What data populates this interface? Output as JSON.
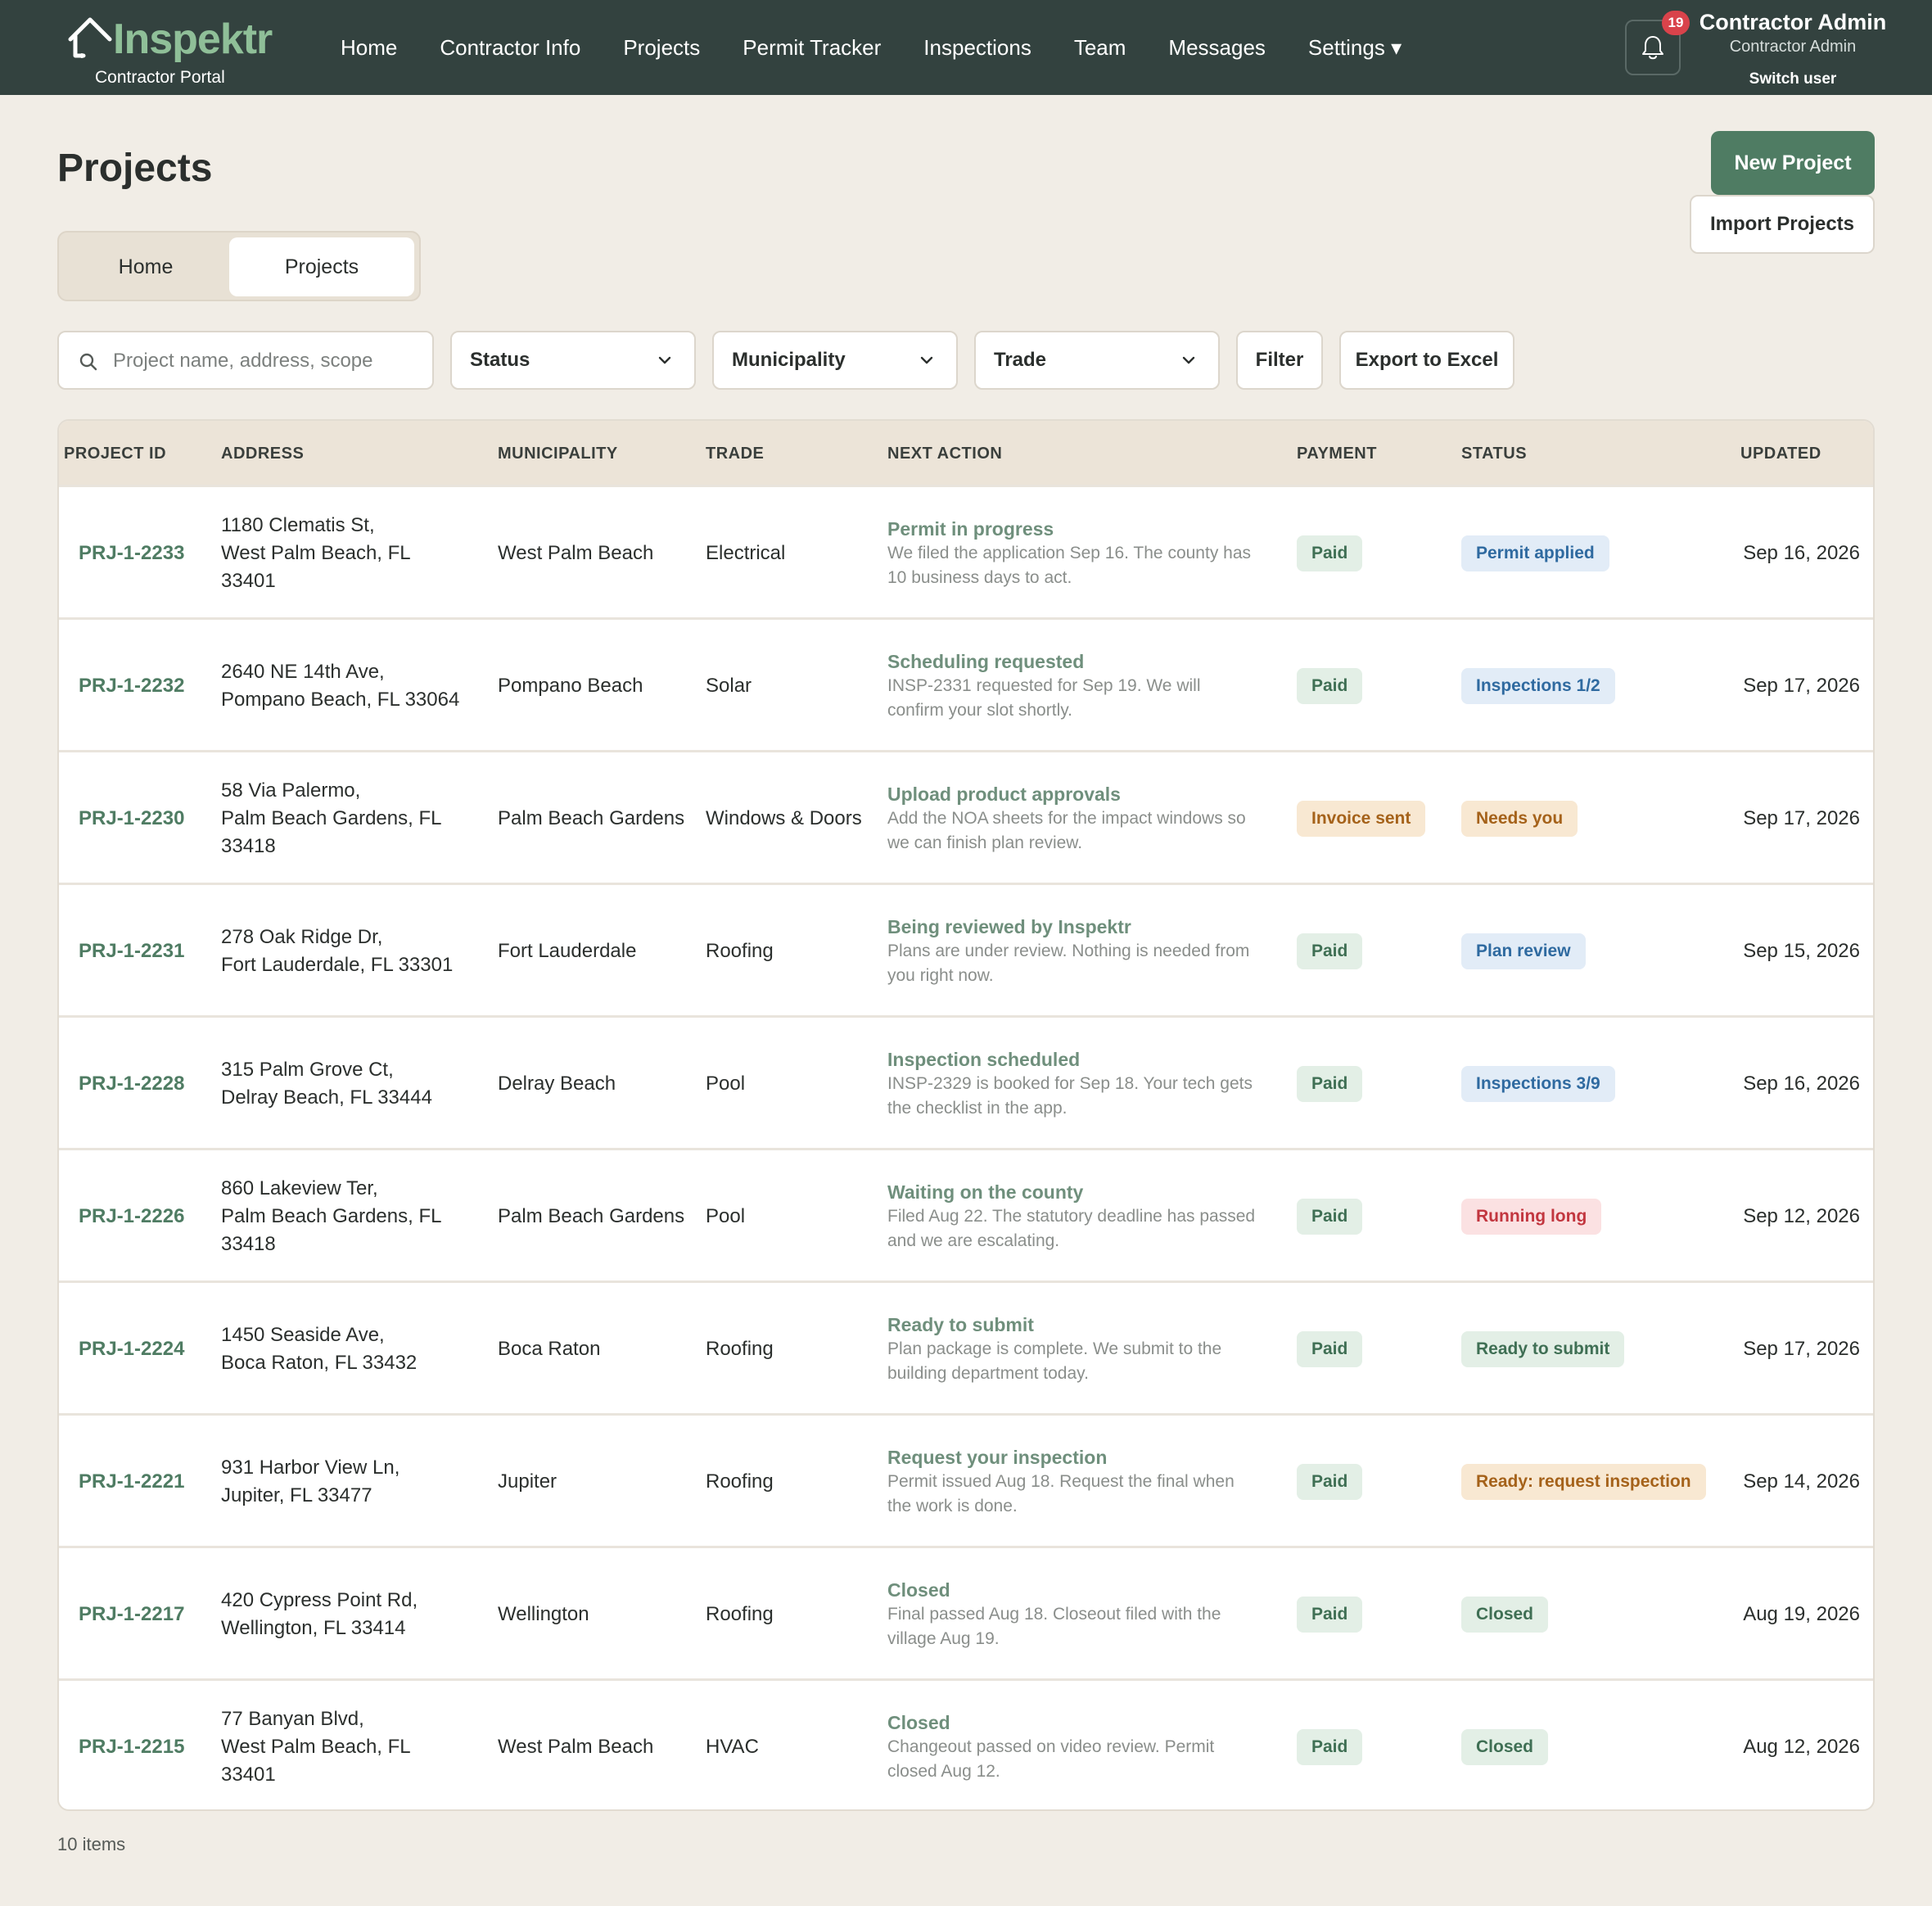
{
  "brand": {
    "name": "Inspektr",
    "subtitle": "Contractor Portal"
  },
  "nav": [
    "Home",
    "Contractor Info",
    "Projects",
    "Permit Tracker",
    "Inspections",
    "Team",
    "Messages",
    "Settings ▾"
  ],
  "notifications": {
    "count": "19"
  },
  "user": {
    "name": "Contractor Admin",
    "role": "Contractor Admin",
    "switch_label": "Switch user"
  },
  "page": {
    "title": "Projects",
    "new_project_label": "New Project",
    "import_projects_label": "Import Projects"
  },
  "tabs": {
    "home": "Home",
    "projects": "Projects",
    "active": "Projects"
  },
  "filters": {
    "search_placeholder": "Project name, address, scope",
    "search_value": "",
    "status_label": "Status",
    "municipality_label": "Municipality",
    "trade_label": "Trade",
    "filter_label": "Filter",
    "export_label": "Export to Excel"
  },
  "table": {
    "headers": [
      "PROJECT ID",
      "ADDRESS",
      "MUNICIPALITY",
      "TRADE",
      "NEXT ACTION",
      "PAYMENT",
      "STATUS",
      "UPDATED"
    ],
    "rows": [
      {
        "id": "PRJ-1-2233",
        "address_line1": "1180 Clematis St,",
        "address_line2": "West Palm Beach, FL",
        "address_line3": "33401",
        "municipality": "West Palm Beach",
        "trade": "Electrical",
        "next_title": "Permit in progress",
        "next_desc": "We filed the application Sep 16. The county has 10 business days to act.",
        "payment": "Paid",
        "payment_tone": "green",
        "status": "Permit applied",
        "status_tone": "blue",
        "updated": "Sep 16, 2026"
      },
      {
        "id": "PRJ-1-2232",
        "address_line1": "2640 NE 14th Ave,",
        "address_line2": "Pompano Beach, FL 33064",
        "address_line3": "",
        "municipality": "Pompano Beach",
        "trade": "Solar",
        "next_title": "Scheduling requested",
        "next_desc": "INSP-2331 requested for Sep 19. We will confirm your slot shortly.",
        "payment": "Paid",
        "payment_tone": "green",
        "status": "Inspections 1/2",
        "status_tone": "blue",
        "updated": "Sep 17, 2026"
      },
      {
        "id": "PRJ-1-2230",
        "address_line1": "58 Via Palermo,",
        "address_line2": "Palm Beach Gardens, FL",
        "address_line3": "33418",
        "municipality": "Palm Beach Gardens",
        "trade": "Windows & Doors",
        "next_title": "Upload product approvals",
        "next_desc": "Add the NOA sheets for the impact windows so we can finish plan review.",
        "payment": "Invoice sent",
        "payment_tone": "amber",
        "status": "Needs you",
        "status_tone": "amber",
        "updated": "Sep 17, 2026"
      },
      {
        "id": "PRJ-1-2231",
        "address_line1": "278 Oak Ridge Dr,",
        "address_line2": "Fort Lauderdale, FL 33301",
        "address_line3": "",
        "municipality": "Fort Lauderdale",
        "trade": "Roofing",
        "next_title": "Being reviewed by Inspektr",
        "next_desc": "Plans are under review. Nothing is needed from you right now.",
        "payment": "Paid",
        "payment_tone": "green",
        "status": "Plan review",
        "status_tone": "blue",
        "updated": "Sep 15, 2026"
      },
      {
        "id": "PRJ-1-2228",
        "address_line1": "315 Palm Grove Ct,",
        "address_line2": "Delray Beach, FL 33444",
        "address_line3": "",
        "municipality": "Delray Beach",
        "trade": "Pool",
        "next_title": "Inspection scheduled",
        "next_desc": "INSP-2329 is booked for Sep 18. Your tech gets the checklist in the app.",
        "payment": "Paid",
        "payment_tone": "green",
        "status": "Inspections 3/9",
        "status_tone": "blue",
        "updated": "Sep 16, 2026"
      },
      {
        "id": "PRJ-1-2226",
        "address_line1": "860 Lakeview Ter,",
        "address_line2": "Palm Beach Gardens, FL",
        "address_line3": "33418",
        "municipality": "Palm Beach Gardens",
        "trade": "Pool",
        "next_title": "Waiting on the county",
        "next_desc": "Filed Aug 22. The statutory deadline has passed and we are escalating.",
        "payment": "Paid",
        "payment_tone": "green",
        "status": "Running long",
        "status_tone": "red",
        "updated": "Sep 12, 2026"
      },
      {
        "id": "PRJ-1-2224",
        "address_line1": "1450 Seaside Ave,",
        "address_line2": "Boca Raton, FL 33432",
        "address_line3": "",
        "municipality": "Boca Raton",
        "trade": "Roofing",
        "next_title": "Ready to submit",
        "next_desc": "Plan package is complete. We submit to the building department today.",
        "payment": "Paid",
        "payment_tone": "green",
        "status": "Ready to submit",
        "status_tone": "green",
        "updated": "Sep 17, 2026"
      },
      {
        "id": "PRJ-1-2221",
        "address_line1": "931 Harbor View Ln,",
        "address_line2": "Jupiter, FL 33477",
        "address_line3": "",
        "municipality": "Jupiter",
        "trade": "Roofing",
        "next_title": "Request your inspection",
        "next_desc": "Permit issued Aug 18. Request the final when the work is done.",
        "payment": "Paid",
        "payment_tone": "green",
        "status": "Ready: request inspection",
        "status_tone": "amber",
        "updated": "Sep 14, 2026"
      },
      {
        "id": "PRJ-1-2217",
        "address_line1": "420 Cypress Point Rd,",
        "address_line2": "Wellington, FL 33414",
        "address_line3": "",
        "municipality": "Wellington",
        "trade": "Roofing",
        "next_title": "Closed",
        "next_desc": "Final passed Aug 18. Closeout filed with the village Aug 19.",
        "payment": "Paid",
        "payment_tone": "green",
        "status": "Closed",
        "status_tone": "green",
        "updated": "Aug 19, 2026"
      },
      {
        "id": "PRJ-1-2215",
        "address_line1": "77 Banyan Blvd,",
        "address_line2": "West Palm Beach, FL",
        "address_line3": "33401",
        "municipality": "West Palm Beach",
        "trade": "HVAC",
        "next_title": "Closed",
        "next_desc": "Changeout passed on video review. Permit closed Aug 12.",
        "payment": "Paid",
        "payment_tone": "green",
        "status": "Closed",
        "status_tone": "green",
        "updated": "Aug 12, 2026"
      }
    ]
  },
  "footer": {
    "items_count": "10 items"
  },
  "colors": {
    "topbar": "#33423f",
    "brand_green": "#8fbf98",
    "accent": "#4f7c63",
    "page_bg": "#f1ede6",
    "notification_badge": "#d9434b"
  }
}
